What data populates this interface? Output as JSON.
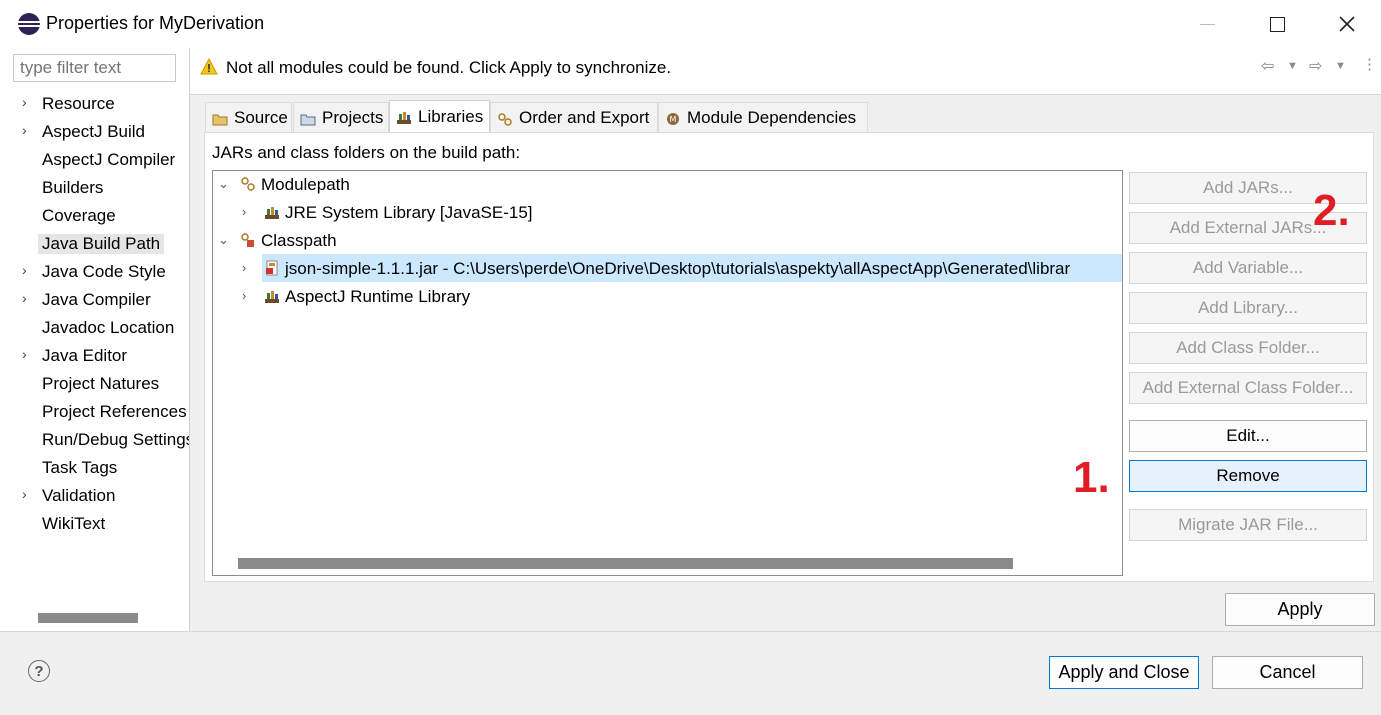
{
  "window": {
    "title": "Properties for MyDerivation"
  },
  "filter": {
    "placeholder": "type filter text"
  },
  "nav": {
    "items": [
      {
        "label": "Resource",
        "expandable": true
      },
      {
        "label": "AspectJ Build",
        "expandable": true
      },
      {
        "label": "AspectJ Compiler",
        "expandable": false
      },
      {
        "label": "Builders",
        "expandable": false
      },
      {
        "label": "Coverage",
        "expandable": false
      },
      {
        "label": "Java Build Path",
        "expandable": false,
        "selected": true
      },
      {
        "label": "Java Code Style",
        "expandable": true
      },
      {
        "label": "Java Compiler",
        "expandable": true
      },
      {
        "label": "Javadoc Location",
        "expandable": false
      },
      {
        "label": "Java Editor",
        "expandable": true
      },
      {
        "label": "Project Natures",
        "expandable": false
      },
      {
        "label": "Project References",
        "expandable": false
      },
      {
        "label": "Run/Debug Settings",
        "expandable": false
      },
      {
        "label": "Task Tags",
        "expandable": false
      },
      {
        "label": "Validation",
        "expandable": true
      },
      {
        "label": "WikiText",
        "expandable": false
      }
    ]
  },
  "message": {
    "text": "Not all modules could be found. Click Apply to synchronize.",
    "icon": "warning-icon"
  },
  "tabs": [
    {
      "label": "Source",
      "icon": "source-folder-icon"
    },
    {
      "label": "Projects",
      "icon": "projects-icon"
    },
    {
      "label": "Libraries",
      "icon": "libraries-icon",
      "active": true
    },
    {
      "label": "Order and Export",
      "icon": "order-export-icon"
    },
    {
      "label": "Module Dependencies",
      "icon": "module-icon"
    }
  ],
  "libraries": {
    "caption": "JARs and class folders on the build path:",
    "tree": [
      {
        "label": "Modulepath",
        "icon": "modulepath-icon"
      },
      {
        "label": "JRE System Library [JavaSE-15]",
        "icon": "library-icon"
      },
      {
        "label": "Classpath",
        "icon": "classpath-icon"
      },
      {
        "label": "json-simple-1.1.1.jar - C:\\Users\\perde\\OneDrive\\Desktop\\tutorials\\aspekty\\allAspectApp\\Generated\\librar",
        "icon": "jar-icon",
        "selected": true
      },
      {
        "label": "AspectJ Runtime Library",
        "icon": "library-icon"
      }
    ]
  },
  "buttons": {
    "add_jars": "Add JARs...",
    "add_external_jars": "Add External JARs...",
    "add_variable": "Add Variable...",
    "add_library": "Add Library...",
    "add_class_folder": "Add Class Folder...",
    "add_external_class_folder": "Add External Class Folder...",
    "edit": "Edit...",
    "remove": "Remove",
    "migrate_jar": "Migrate JAR File...",
    "apply": "Apply",
    "apply_and_close": "Apply and Close",
    "cancel": "Cancel"
  },
  "annotations": {
    "step1": "1.",
    "step2": "2."
  },
  "colors": {
    "selection": "#cce8ff",
    "annotation": "#e01c24",
    "focus_border": "#0078d7"
  }
}
